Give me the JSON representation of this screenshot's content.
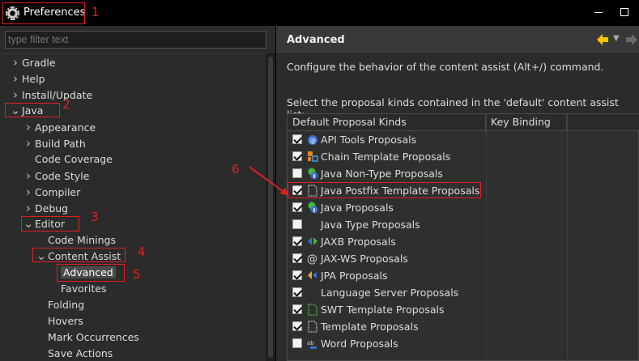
{
  "window": {
    "title": "Preferences"
  },
  "filter": {
    "placeholder": "type filter text"
  },
  "tree": [
    {
      "label": "Gradle",
      "level": 0,
      "state": "closed"
    },
    {
      "label": "Help",
      "level": 0,
      "state": "closed"
    },
    {
      "label": "Install/Update",
      "level": 0,
      "state": "closed"
    },
    {
      "label": "Java",
      "level": 0,
      "state": "open"
    },
    {
      "label": "Appearance",
      "level": 1,
      "state": "closed"
    },
    {
      "label": "Build Path",
      "level": 1,
      "state": "closed"
    },
    {
      "label": "Code Coverage",
      "level": 1,
      "state": "none"
    },
    {
      "label": "Code Style",
      "level": 1,
      "state": "closed"
    },
    {
      "label": "Compiler",
      "level": 1,
      "state": "closed"
    },
    {
      "label": "Debug",
      "level": 1,
      "state": "closed"
    },
    {
      "label": "Editor",
      "level": 1,
      "state": "open"
    },
    {
      "label": "Code Minings",
      "level": 2,
      "state": "none"
    },
    {
      "label": "Content Assist",
      "level": 2,
      "state": "open"
    },
    {
      "label": "Advanced",
      "level": 3,
      "state": "none",
      "selected": true
    },
    {
      "label": "Favorites",
      "level": 3,
      "state": "none"
    },
    {
      "label": "Folding",
      "level": 2,
      "state": "none"
    },
    {
      "label": "Hovers",
      "level": 2,
      "state": "none"
    },
    {
      "label": "Mark Occurrences",
      "level": 2,
      "state": "none"
    },
    {
      "label": "Save Actions",
      "level": 2,
      "state": "none"
    }
  ],
  "page": {
    "title": "Advanced",
    "description": "Configure the behavior of the content assist (Alt+/) command.",
    "list_label": "Select the proposal kinds contained in the 'default' content assist list:",
    "columns": [
      "Default Proposal Kinds",
      "Key Binding"
    ],
    "proposals": [
      {
        "label": "API Tools Proposals",
        "checked": true,
        "icon": "api-tools-icon"
      },
      {
        "label": "Chain Template Proposals",
        "checked": true,
        "icon": "chain-template-icon"
      },
      {
        "label": "Java Non-Type Proposals",
        "checked": false,
        "icon": "java-proposal-icon"
      },
      {
        "label": "Java Postfix Template Proposals",
        "checked": true,
        "icon": "template-file-icon"
      },
      {
        "label": "Java Proposals",
        "checked": true,
        "icon": "java-proposal-icon"
      },
      {
        "label": "Java Type Proposals",
        "checked": false,
        "icon": "java-type-icon"
      },
      {
        "label": "JAXB Proposals",
        "checked": true,
        "icon": "jaxb-icon"
      },
      {
        "label": "JAX-WS Proposals",
        "checked": true,
        "icon": "at-sign-icon"
      },
      {
        "label": "JPA Proposals",
        "checked": true,
        "icon": "jpa-icon"
      },
      {
        "label": "Language Server Proposals",
        "checked": true,
        "icon": ""
      },
      {
        "label": "SWT Template Proposals",
        "checked": true,
        "icon": "swt-template-icon"
      },
      {
        "label": "Template Proposals",
        "checked": true,
        "icon": "template-file-icon"
      },
      {
        "label": "Word Proposals",
        "checked": false,
        "icon": "word-completion-icon"
      }
    ]
  },
  "annotations": [
    "1",
    "2",
    "3",
    "4",
    "5",
    "6"
  ],
  "colors": {
    "annotation": "#e02020",
    "nav_arrow": "#f5c400"
  }
}
